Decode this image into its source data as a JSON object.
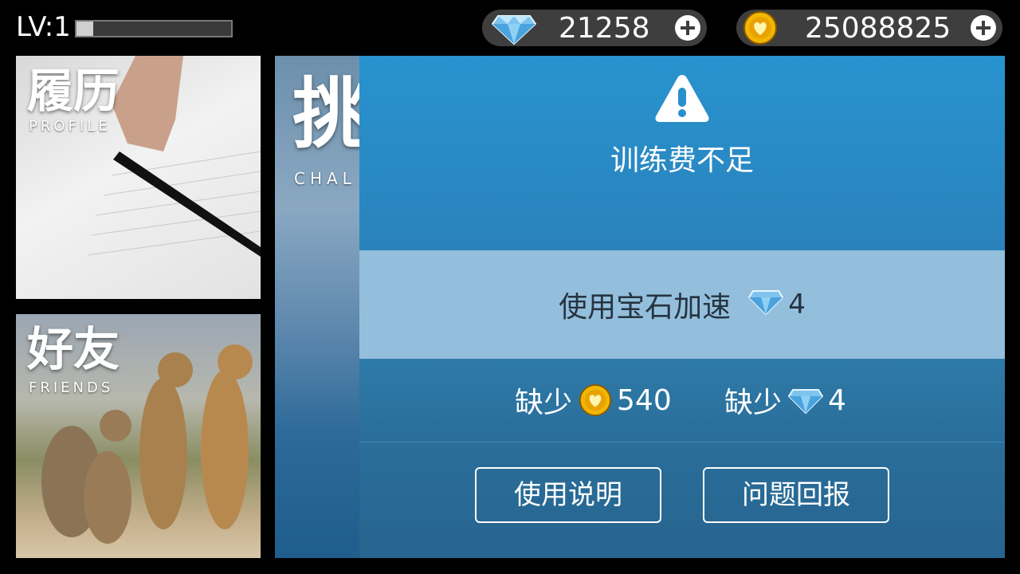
{
  "hud": {
    "level": "LV:1",
    "xp_progress": 0.11,
    "gems": "21258",
    "coins": "25088825"
  },
  "tiles": {
    "profile": {
      "title": "履历",
      "subtitle": "PROFILE"
    },
    "friends": {
      "title": "好友",
      "subtitle": "FRIENDS"
    },
    "challenge": {
      "title": "挑",
      "subtitle": "CHAL"
    }
  },
  "dialog": {
    "title": "训练费不足",
    "speedup_label": "使用宝石加速",
    "speedup_cost": "4",
    "lack_label_1": "缺少",
    "lack_coins": "540",
    "lack_label_2": "缺少",
    "lack_gems": "4",
    "help_button": "使用说明",
    "report_button": "问题回报"
  },
  "colors": {
    "dialog_top": "#2893cf",
    "speed_band": "#93bfdc",
    "dialog_body": "#2a6e9a"
  },
  "icons": [
    "gem-icon",
    "coin-icon",
    "plus-icon",
    "warning-icon"
  ]
}
